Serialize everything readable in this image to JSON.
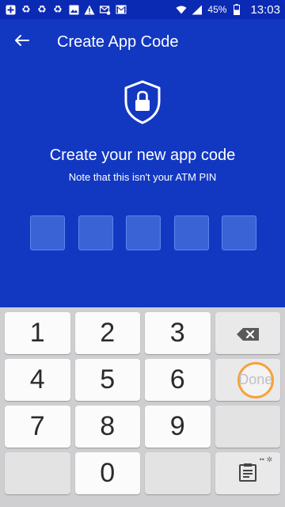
{
  "status_bar": {
    "battery_percent": "45%",
    "time": "13:03",
    "icons": [
      "plus-box-icon",
      "recycle-icon",
      "recycle-icon",
      "recycle-icon",
      "image-icon",
      "warning-icon",
      "mail-settings-icon",
      "gmail-icon",
      "wifi-icon",
      "signal-icon",
      "battery-icon"
    ]
  },
  "app_bar": {
    "title": "Create App Code",
    "back_icon": "arrow-left-icon"
  },
  "content": {
    "icon": "shield-lock-icon",
    "headline": "Create your new app code",
    "note": "Note that this isn't your ATM PIN",
    "pin_length": 5
  },
  "keypad": {
    "rows": [
      [
        "1",
        "2",
        "3",
        "backspace"
      ],
      [
        "4",
        "5",
        "6",
        "Done"
      ],
      [
        "7",
        "8",
        "9",
        ""
      ],
      [
        "",
        "0",
        "",
        "clipboard"
      ]
    ],
    "done_label": "Done"
  },
  "colors": {
    "background": "#1238c2",
    "status_bar": "#0b2ab3",
    "pin_box": "#3a63d6",
    "keypad_bg": "#cfcfd1",
    "done_ring": "#f7a23b"
  }
}
